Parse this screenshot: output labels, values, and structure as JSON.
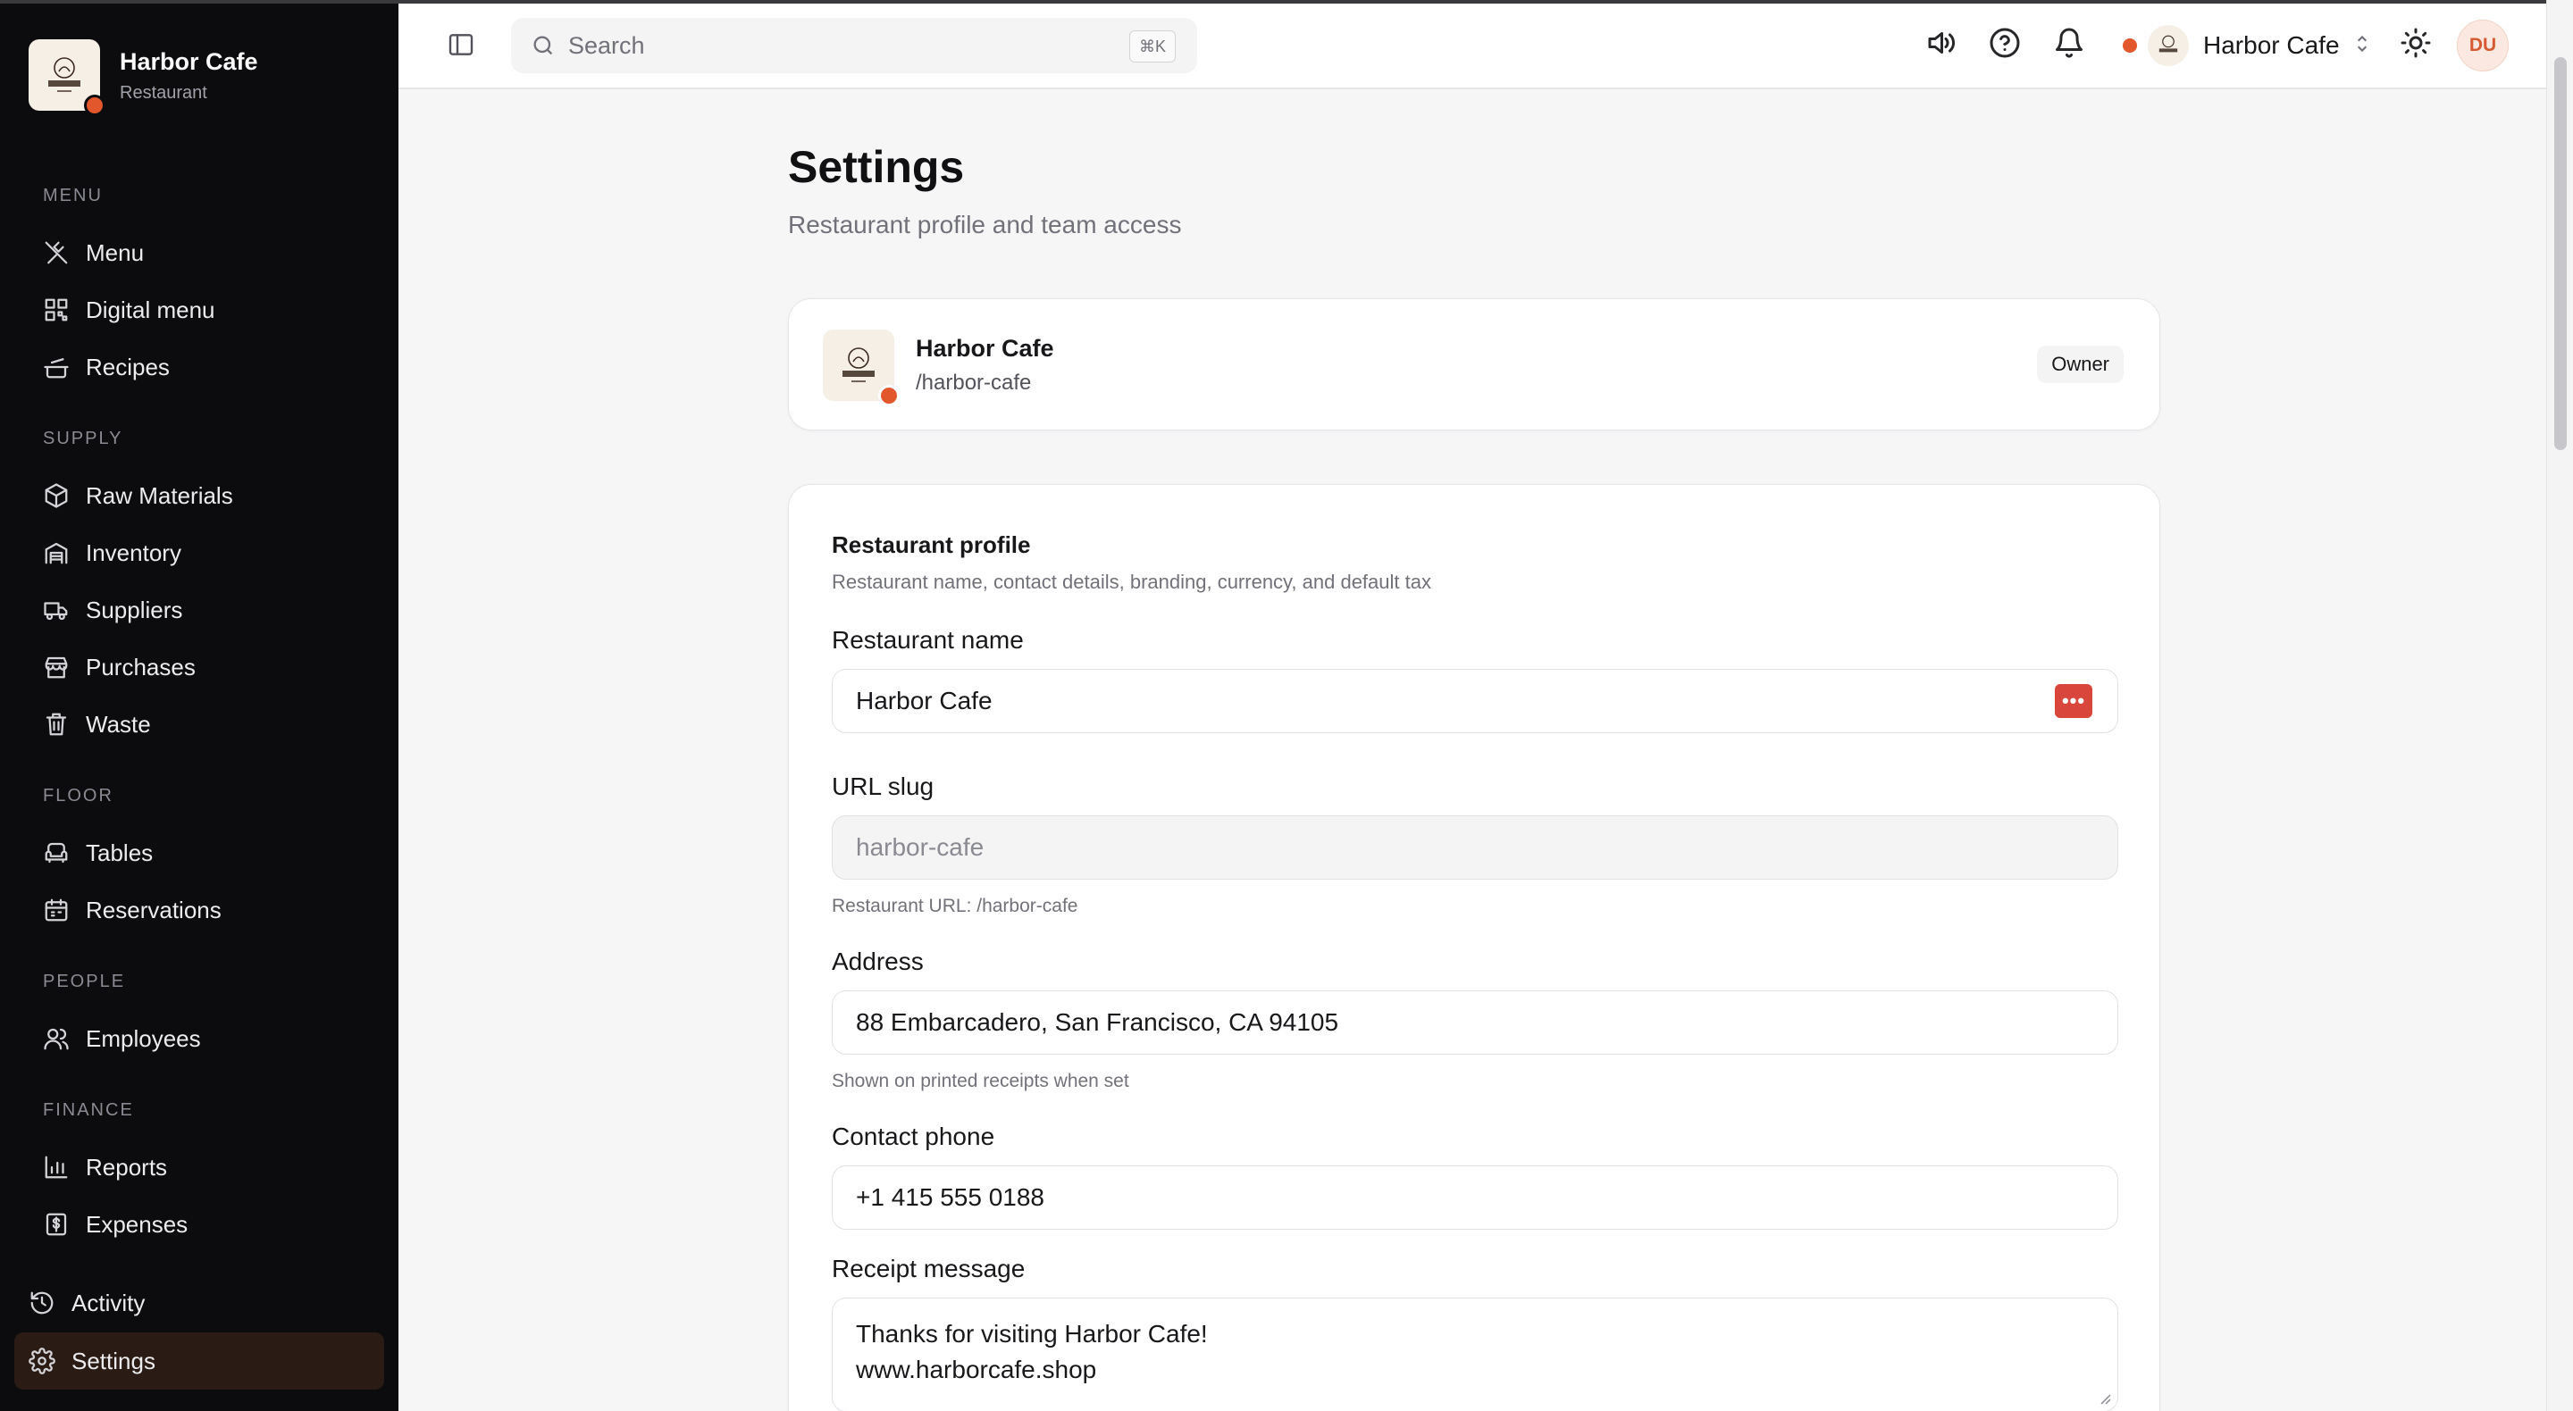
{
  "sidebar": {
    "brand_name": "Harbor Cafe",
    "brand_sub": "Restaurant",
    "sections": {
      "menu": "MENU",
      "supply": "SUPPLY",
      "floor": "FLOOR",
      "people": "PEOPLE",
      "finance": "FINANCE"
    },
    "items": {
      "menu": "Menu",
      "digital_menu": "Digital menu",
      "recipes": "Recipes",
      "raw_materials": "Raw Materials",
      "inventory": "Inventory",
      "suppliers": "Suppliers",
      "purchases": "Purchases",
      "waste": "Waste",
      "tables": "Tables",
      "reservations": "Reservations",
      "employees": "Employees",
      "reports": "Reports",
      "expenses": "Expenses",
      "activity": "Activity",
      "settings": "Settings"
    },
    "active_item": "Settings"
  },
  "topbar": {
    "search_placeholder": "Search",
    "search_shortcut": "⌘K",
    "restaurant_name": "Harbor Cafe",
    "avatar_initials": "DU"
  },
  "page": {
    "title": "Settings",
    "subtitle": "Restaurant profile and team access"
  },
  "org_card": {
    "name": "Harbor Cafe",
    "slug": "/harbor-cafe",
    "role": "Owner"
  },
  "profile": {
    "title": "Restaurant profile",
    "subtitle": "Restaurant name, contact details, branding, currency, and default tax",
    "name_label": "Restaurant name",
    "name_value": "Harbor Cafe",
    "slug_label": "URL slug",
    "slug_value": "harbor-cafe",
    "slug_hint": "Restaurant URL: /harbor-cafe",
    "address_label": "Address",
    "address_value": "88 Embarcadero, San Francisco, CA 94105",
    "address_hint": "Shown on printed receipts when set",
    "phone_label": "Contact phone",
    "phone_value": "+1 415 555 0188",
    "receipt_label": "Receipt message",
    "receipt_line1": "Thanks for visiting Harbor Cafe!",
    "receipt_line2": "www.harborcafe.shop"
  },
  "colors": {
    "accent": "#e2572b",
    "sidebar_bg": "#0c0c0f",
    "active_bg": "#2a1c14"
  }
}
